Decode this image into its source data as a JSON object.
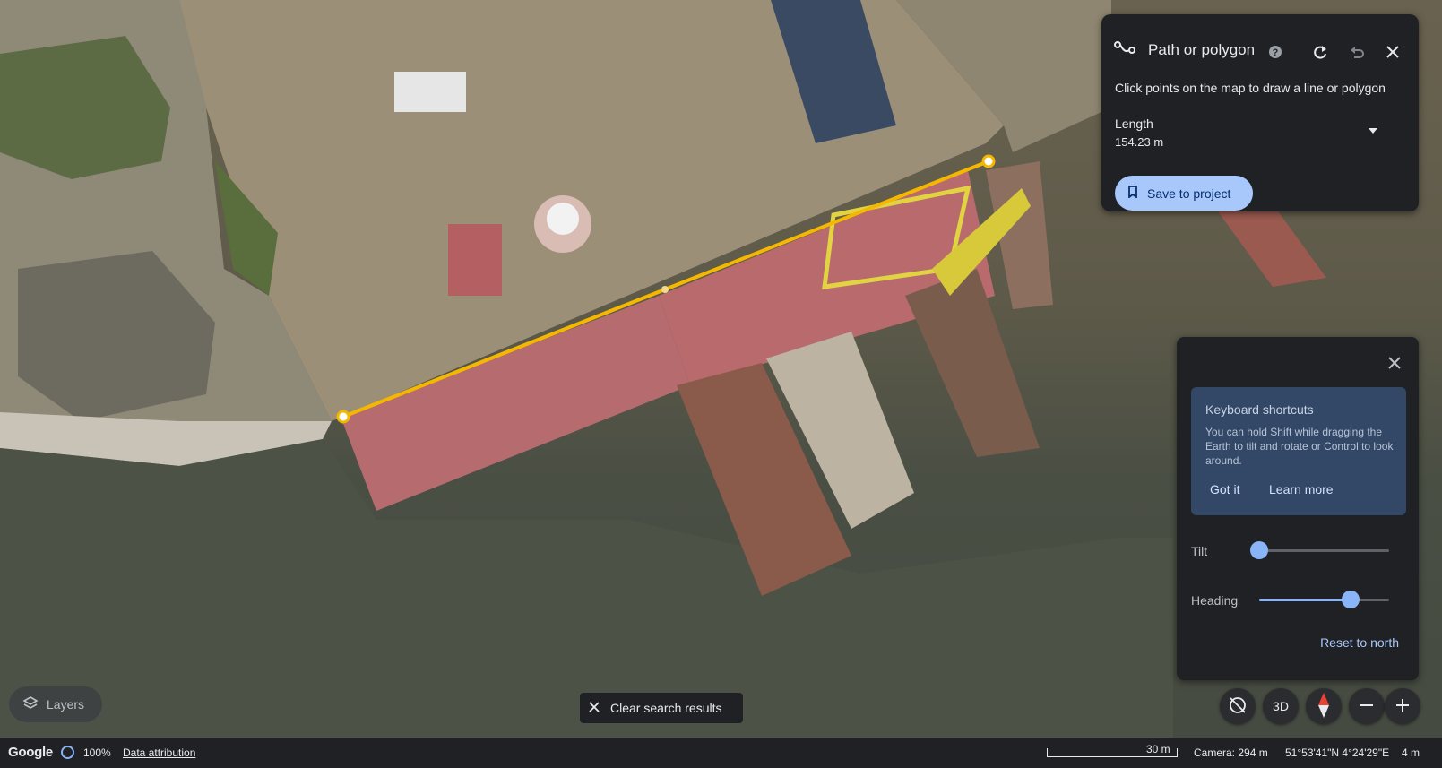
{
  "path_panel": {
    "title": "Path or polygon",
    "instruction": "Click points on the map to draw a line or polygon",
    "length_label": "Length",
    "length_value": "154.23 m",
    "save_label": "Save to project"
  },
  "shortcuts": {
    "title": "Keyboard shortcuts",
    "body": "You can hold Shift while dragging the Earth to tilt and rotate or Control to look around.",
    "got_it": "Got it",
    "learn_more": "Learn more"
  },
  "nav": {
    "tilt_label": "Tilt",
    "tilt_level": 0,
    "heading_label": "Heading",
    "heading_level": 0.7,
    "reset_label": "Reset to north"
  },
  "controls": {
    "layers_label": "Layers",
    "clear_label": "Clear search results",
    "three_d_label": "3D"
  },
  "status": {
    "brand": "Google",
    "load_pct": "100%",
    "attribution": "Data attribution",
    "scale": "30 m",
    "camera": "Camera: 294 m",
    "coords": "51°53'41\"N 4°24'29\"E",
    "altitude": "4 m"
  },
  "colors": {
    "accent": "#a8c7fa",
    "path": "#f5b800",
    "panel": "#202124"
  },
  "icons": [
    "path-icon",
    "help-icon",
    "redo-icon",
    "undo-icon",
    "close-icon",
    "bookmark-icon",
    "chevron-down-icon",
    "layers-icon",
    "rotate-off-icon",
    "compass-icon",
    "minus-icon",
    "plus-icon"
  ]
}
